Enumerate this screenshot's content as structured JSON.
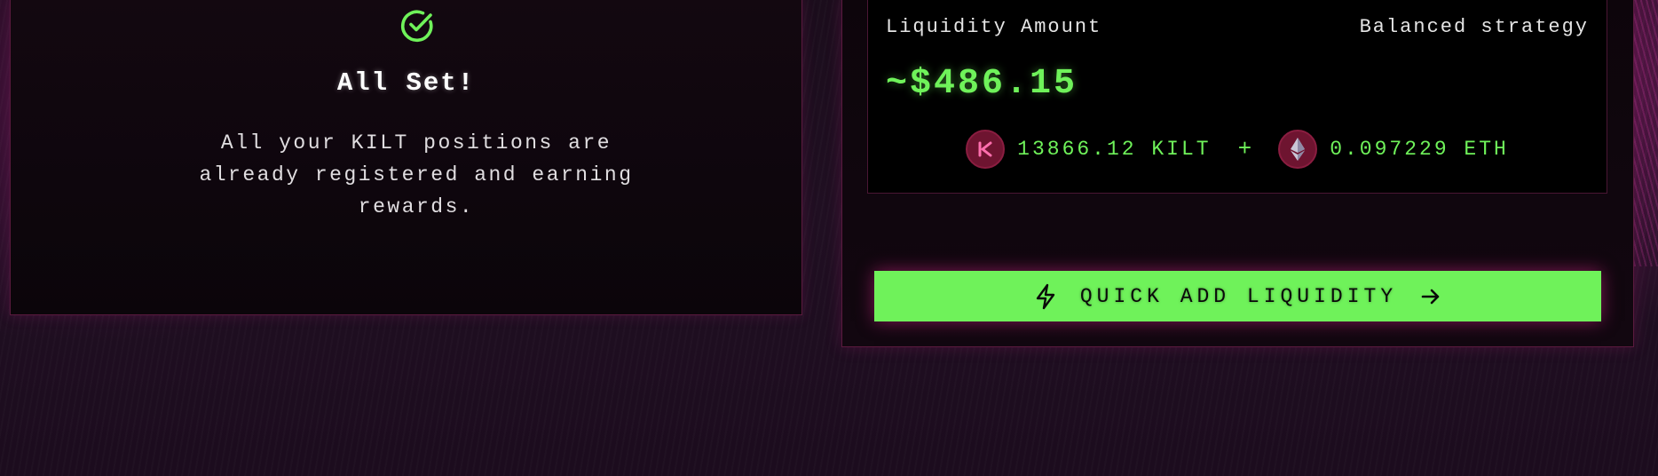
{
  "status_card": {
    "title": "All Set!",
    "message": "All your KILT positions are already registered and earning rewards.",
    "icon": "check-circle-icon"
  },
  "liquidity": {
    "amount_label": "Liquidity Amount",
    "strategy_label": "Balanced strategy",
    "amount_value": "~$486.15",
    "tokens": [
      {
        "symbol_icon": "kilt-token-icon",
        "amount": "13866.12 KILT"
      },
      {
        "symbol_icon": "eth-token-icon",
        "amount": "0.097229 ETH"
      }
    ],
    "plus": "+",
    "button_label": "QUICK ADD LIQUIDITY"
  },
  "colors": {
    "accent_green": "#6ff25a",
    "card_border": "#5a1a3e",
    "token_badge": "#6e1430",
    "background": "#1b0d1c"
  }
}
